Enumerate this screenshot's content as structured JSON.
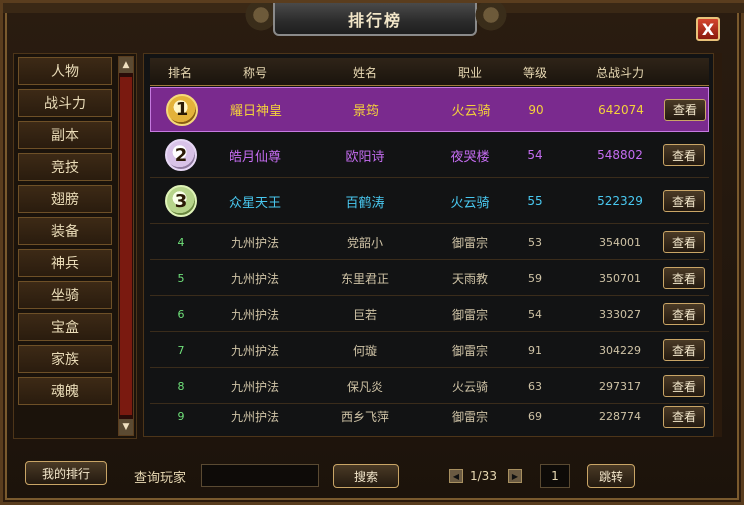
{
  "window": {
    "title": "排行榜",
    "close_label": "X"
  },
  "sidebar": {
    "items": [
      {
        "label": "人物"
      },
      {
        "label": "战斗力"
      },
      {
        "label": "副本"
      },
      {
        "label": "竞技"
      },
      {
        "label": "翅膀"
      },
      {
        "label": "装备"
      },
      {
        "label": "神兵"
      },
      {
        "label": "坐骑"
      },
      {
        "label": "宝盒"
      },
      {
        "label": "家族"
      },
      {
        "label": "魂魄"
      }
    ],
    "scroll_up": "▲",
    "scroll_down": "▼"
  },
  "table": {
    "headers": {
      "rank": "排名",
      "title": "称号",
      "name": "姓名",
      "class": "职业",
      "level": "等级",
      "power": "总战斗力"
    },
    "view_label": "查看",
    "rows": [
      {
        "rank": "1",
        "title": "耀日神皇",
        "name": "景筠",
        "class": "火云骑",
        "level": "90",
        "power": "642074"
      },
      {
        "rank": "2",
        "title": "皓月仙尊",
        "name": "欧阳诗",
        "class": "夜哭楼",
        "level": "54",
        "power": "548802"
      },
      {
        "rank": "3",
        "title": "众星天王",
        "name": "百鹤涛",
        "class": "火云骑",
        "level": "55",
        "power": "522329"
      },
      {
        "rank": "4",
        "title": "九州护法",
        "name": "党韶小",
        "class": "御雷宗",
        "level": "53",
        "power": "354001"
      },
      {
        "rank": "5",
        "title": "九州护法",
        "name": "东里君正",
        "class": "天雨教",
        "level": "59",
        "power": "350701"
      },
      {
        "rank": "6",
        "title": "九州护法",
        "name": "巨若",
        "class": "御雷宗",
        "level": "54",
        "power": "333027"
      },
      {
        "rank": "7",
        "title": "九州护法",
        "name": "何璇",
        "class": "御雷宗",
        "level": "91",
        "power": "304229"
      },
      {
        "rank": "8",
        "title": "九州护法",
        "name": "保凡炎",
        "class": "火云骑",
        "level": "63",
        "power": "297317"
      },
      {
        "rank": "9",
        "title": "九州护法",
        "name": "西乡飞萍",
        "class": "御雷宗",
        "level": "69",
        "power": "228774"
      }
    ]
  },
  "footer": {
    "my_rank_label": "我的排行",
    "query_label": "查询玩家",
    "query_value": "",
    "search_label": "搜索",
    "page_indicator": "1/33",
    "page_input": "1",
    "jump_label": "跳转",
    "prev_arrow": "◀",
    "next_arrow": "▶"
  },
  "colors": {
    "first_row_bg": "#7a2a8e",
    "rank1_text": "#f5d23a",
    "rank2_text": "#c46cf0",
    "rank3_text": "#49c8f0",
    "normal_text": "#cfc3a6"
  }
}
